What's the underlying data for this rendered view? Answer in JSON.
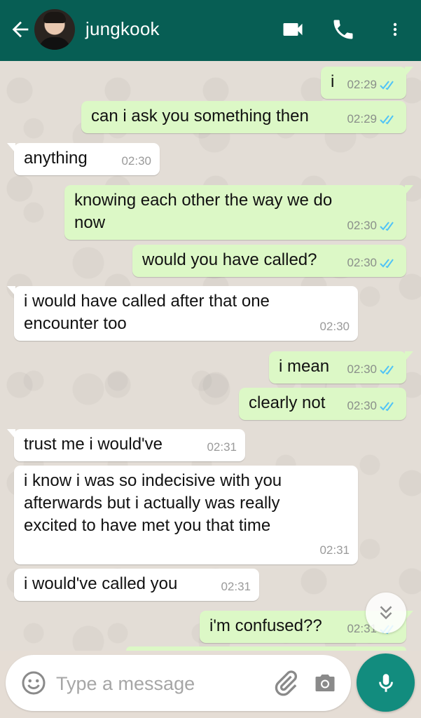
{
  "header": {
    "contact_name": "jungkook",
    "back_icon": "arrow-left-icon",
    "video_icon": "video-camera-icon",
    "call_icon": "phone-icon",
    "menu_icon": "more-vertical-icon"
  },
  "messages": [
    {
      "dir": "out",
      "text": "i",
      "time": "02:29",
      "ticks": "read"
    },
    {
      "dir": "out",
      "text": "can i ask you something then",
      "time": "02:29",
      "ticks": "read"
    },
    {
      "dir": "in",
      "text": "anything",
      "time": "02:30"
    },
    {
      "dir": "out",
      "text": "knowing each other the way we do now",
      "time": "02:30",
      "ticks": "read"
    },
    {
      "dir": "out",
      "text": "would you have called?",
      "time": "02:30",
      "ticks": "read"
    },
    {
      "dir": "in",
      "text": "i would have called after that one encounter too",
      "time": "02:30"
    },
    {
      "dir": "out",
      "text": "i mean",
      "time": "02:30",
      "ticks": "read"
    },
    {
      "dir": "out",
      "text": "clearly not",
      "time": "02:30",
      "ticks": "read"
    },
    {
      "dir": "in",
      "text": "trust me i would've",
      "time": "02:31"
    },
    {
      "dir": "in",
      "text": "i know i was so indecisive with you afterwards but i actually was really excited to have met you that time",
      "time": "02:31"
    },
    {
      "dir": "in",
      "text": "i would've called you",
      "time": "02:31"
    },
    {
      "dir": "out",
      "text": "i'm confused??",
      "time": "02:31",
      "ticks": "read"
    }
  ],
  "composer": {
    "placeholder": "Type a message",
    "emoji_icon": "emoji-icon",
    "attach_icon": "paperclip-icon",
    "camera_icon": "camera-icon",
    "mic_icon": "microphone-icon"
  },
  "colors": {
    "header": "#075e54",
    "outgoing_bubble": "#dcf8c6",
    "incoming_bubble": "#ffffff",
    "read_ticks": "#4fc3f7",
    "mic_button": "#128c7e"
  }
}
